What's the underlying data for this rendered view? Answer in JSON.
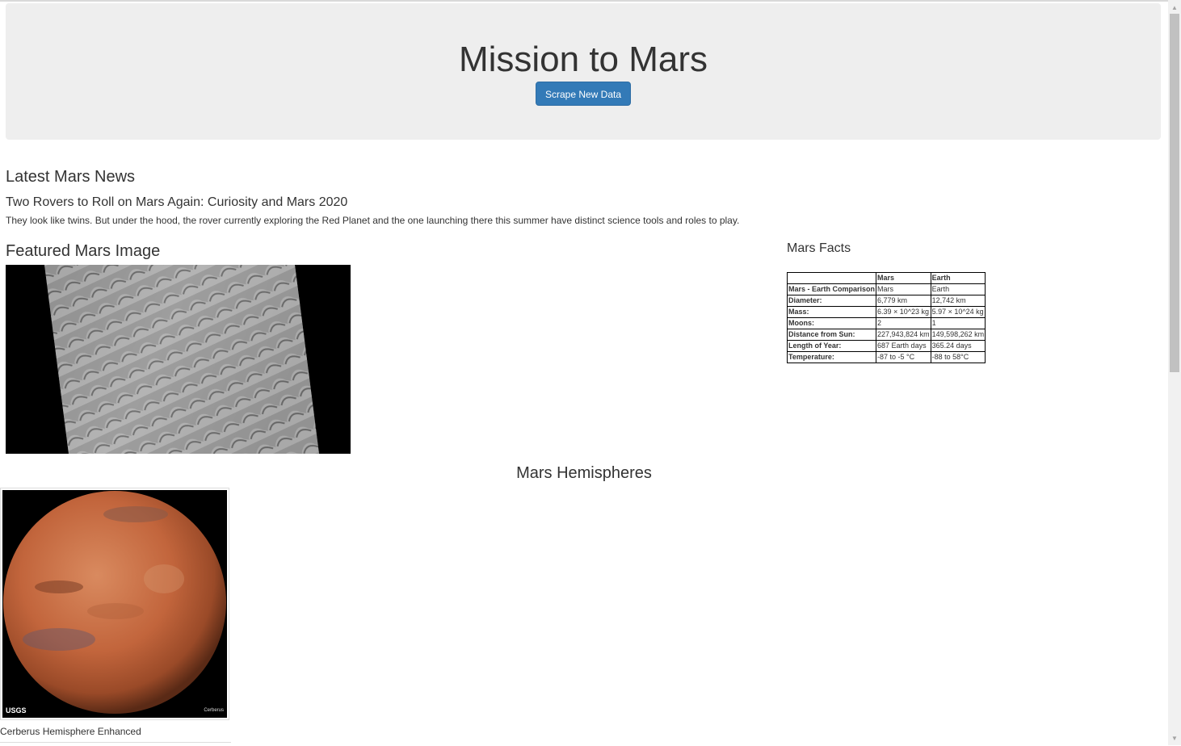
{
  "header": {
    "title": "Mission to Mars",
    "scrape_button": "Scrape New Data"
  },
  "news": {
    "heading": "Latest Mars News",
    "title": "Two Rovers to Roll on Mars Again: Curiosity and Mars 2020",
    "paragraph": "They look like twins. But under the hood, the rover currently exploring the Red Planet and the one launching there this summer have distinct science tools and roles to play."
  },
  "featured": {
    "heading": "Featured Mars Image"
  },
  "facts": {
    "heading": "Mars Facts",
    "columns": [
      "",
      "Mars",
      "Earth"
    ],
    "rows": [
      [
        "Mars - Earth Comparison",
        "Mars",
        "Earth"
      ],
      [
        "Diameter:",
        "6,779 km",
        "12,742 km"
      ],
      [
        "Mass:",
        "6.39 × 10^23 kg",
        "5.97 × 10^24 kg"
      ],
      [
        "Moons:",
        "2",
        "1"
      ],
      [
        "Distance from Sun:",
        "227,943,824 km",
        "149,598,262 km"
      ],
      [
        "Length of Year:",
        "687 Earth days",
        "365.24 days"
      ],
      [
        "Temperature:",
        "-87 to -5 °C",
        "-88 to 58°C"
      ]
    ]
  },
  "hemispheres": {
    "heading": "Mars Hemispheres",
    "items": [
      {
        "caption": "Cerberus Hemisphere Enhanced",
        "logo": "USGS",
        "label": "Cerberus"
      }
    ]
  },
  "colors": {
    "primary": "#337ab7",
    "jumbotron": "#eeeeee",
    "mars": "#c2653c"
  }
}
